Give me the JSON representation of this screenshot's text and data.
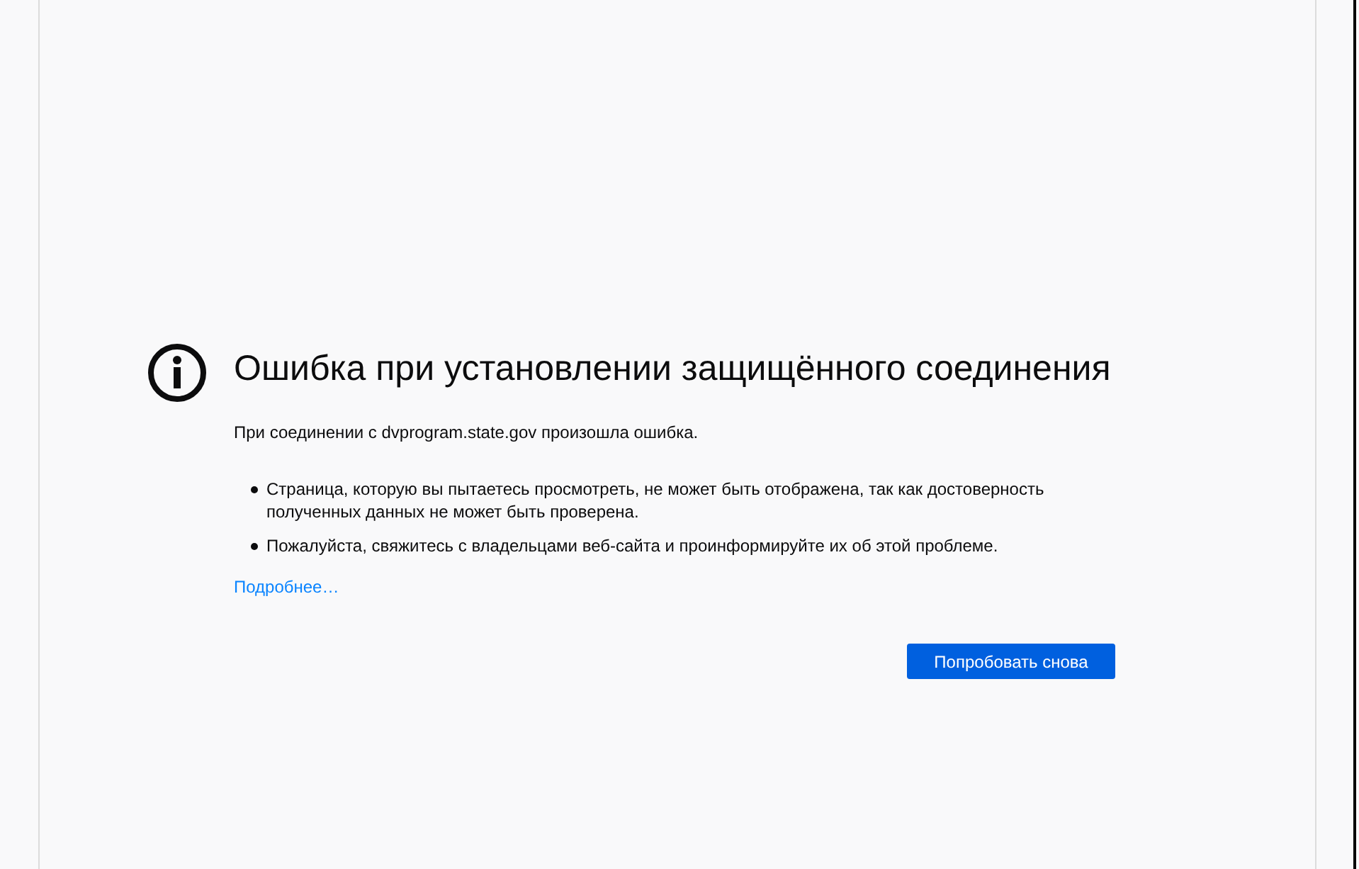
{
  "title": "Ошибка при установлении защищённого соединения",
  "message": "При соединении с dvprogram.state.gov произошла ошибка.",
  "bullets": [
    "Страница, которую вы пытаетесь просмотреть, не может быть отображена, так как достоверность полученных данных не может быть проверена.",
    "Пожалуйста, свяжитесь с владельцами веб-сайта и проинформируйте их об этой проблеме."
  ],
  "link": "Подробнее…",
  "button": "Попробовать снова"
}
